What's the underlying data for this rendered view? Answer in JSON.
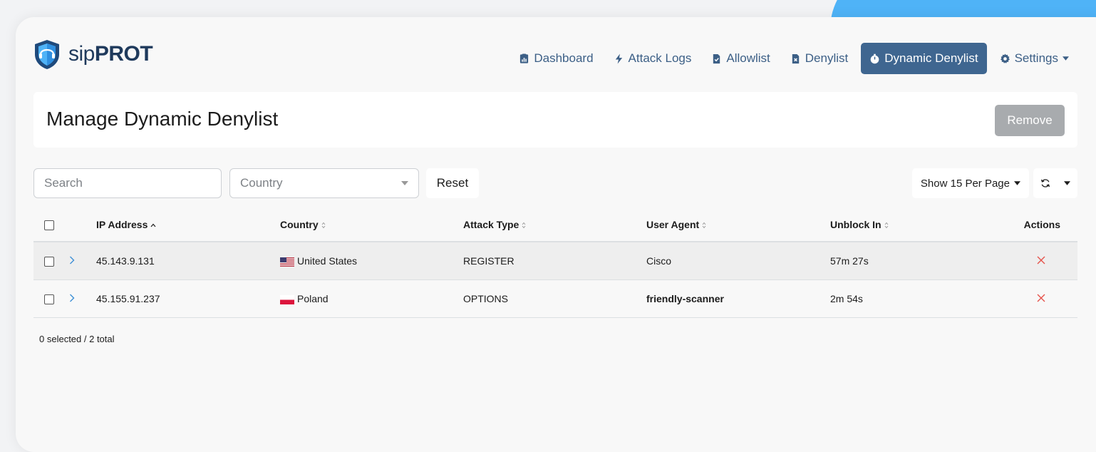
{
  "app": {
    "name_light": "sip",
    "name_bold": "PROT"
  },
  "nav": {
    "items": [
      {
        "label": "Dashboard",
        "icon": "dashboard-icon",
        "active": false
      },
      {
        "label": "Attack Logs",
        "icon": "bolt-icon",
        "active": false
      },
      {
        "label": "Allowlist",
        "icon": "allowlist-icon",
        "active": false
      },
      {
        "label": "Denylist",
        "icon": "denylist-icon",
        "active": false
      },
      {
        "label": "Dynamic Denylist",
        "icon": "stopwatch-icon",
        "active": true
      },
      {
        "label": "Settings",
        "icon": "gear-icon",
        "active": false
      }
    ]
  },
  "page": {
    "title": "Manage Dynamic Denylist",
    "remove_label": "Remove"
  },
  "filters": {
    "search_placeholder": "Search",
    "country_placeholder": "Country",
    "reset_label": "Reset",
    "per_page_label": "Show 15 Per Page"
  },
  "table": {
    "headers": [
      "IP Address",
      "Country",
      "Attack Type",
      "User Agent",
      "Unblock In",
      "Actions"
    ],
    "rows": [
      {
        "ip": "45.143.9.131",
        "country": "United States",
        "flag": "us-flag-icon",
        "attack_type": "REGISTER",
        "user_agent": "Cisco",
        "unblock_in": "57m 27s"
      },
      {
        "ip": "45.155.91.237",
        "country": "Poland",
        "flag": "poland-flag-icon",
        "attack_type": "OPTIONS",
        "user_agent": "friendly-scanner",
        "unblock_in": "2m 54s"
      }
    ]
  },
  "footer": {
    "selection_summary": "0 selected / 2 total"
  },
  "colors": {
    "accent": "#3f6690",
    "nav_text": "#3c5f86",
    "delete": "#e5534b",
    "expand": "#3d8fd6",
    "corner_blob": "#4fb3f7"
  }
}
